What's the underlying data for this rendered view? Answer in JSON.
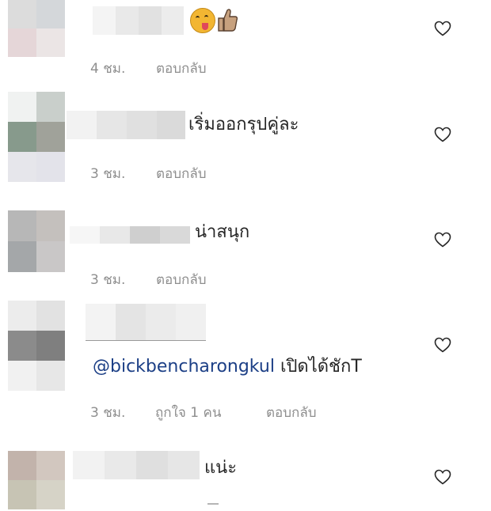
{
  "comments": [
    {
      "avatar_colors": [
        "#dcdcdc",
        "#d4d7da",
        "#e5d6d8",
        "#ebe5e5"
      ],
      "name_blur_colors": [
        "#f4f4f4",
        "#e9e9e9",
        "#e1e1e1",
        "#ececec"
      ],
      "text": "",
      "emojis": [
        "winking-face-tongue-emoji",
        "thumbs-up-emoji"
      ],
      "time": "4 ชม.",
      "likes": "",
      "reply": "ตอบกลับ"
    },
    {
      "avatar_colors": [
        "#f0f2f1",
        "#c9cfcb",
        "#879a8c",
        "#a0a29a",
        "#e6e6eb",
        "#e3e3ea"
      ],
      "name_blur_colors": [
        "#f2f2f2",
        "#e6e6e6",
        "#e0e0e0",
        "#dadada"
      ],
      "text": "เริ่มออกรุปคู่ละ",
      "time": "3 ชม.",
      "likes": "",
      "reply": "ตอบกลับ"
    },
    {
      "avatar_colors": [
        "#b7b7b7",
        "#c4c0bd",
        "#a4a7a9",
        "#c9c7c7"
      ],
      "name_blur_colors": [
        "#f6f6f6",
        "#e8e8e8",
        "#cfcfcf",
        "#d9d9d9"
      ],
      "text": "น่าสนุก",
      "time": "3 ชม.",
      "likes": "",
      "reply": "ตอบกลับ"
    },
    {
      "avatar_colors": [
        "#ececec",
        "#e2e2e2",
        "#8b8b8b",
        "#7f7f7f",
        "#f1f1f1",
        "#e7e7e7"
      ],
      "name_blur_colors": [
        "#f3f3f3",
        "#e4e4e4",
        "#ebebeb",
        "#f0f0f0"
      ],
      "mention": "@bickbencharongkul",
      "text": "เปิดได้ชักT",
      "time": "3 ชม.",
      "likes": "ถูกใจ 1 คน",
      "reply": "ตอบกลับ"
    },
    {
      "avatar_colors": [
        "#c2b3ab",
        "#d2c7bf",
        "#c7c4b4",
        "#d6d3c7"
      ],
      "name_blur_colors": [
        "#f2f2f2",
        "#e9e9e9",
        "#dfdfdf",
        "#e6e6e6"
      ],
      "text": "แน่ะ",
      "time": "",
      "likes": "",
      "reply": ""
    }
  ],
  "colors": {
    "text": "#262626",
    "meta": "#8e8e8e",
    "mention": "#1c3f86",
    "heart_stroke": "#262626"
  },
  "icons": {
    "like": "heart-outline-icon"
  }
}
